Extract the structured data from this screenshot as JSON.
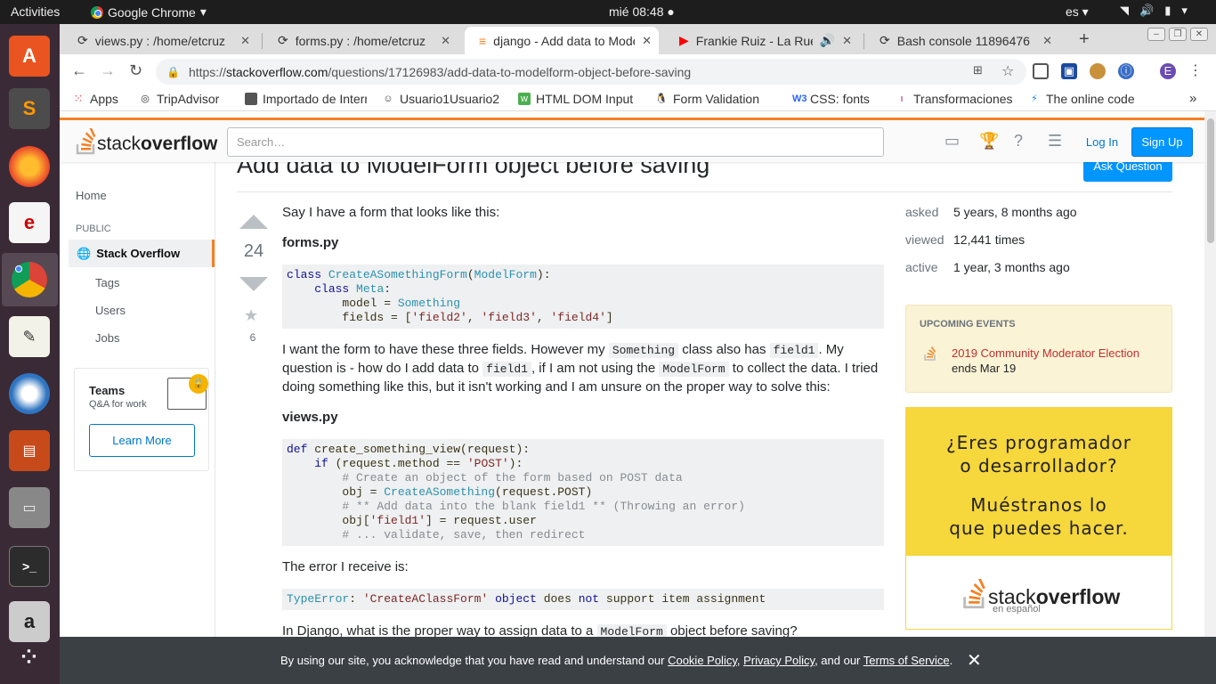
{
  "os": {
    "activities": "Activities",
    "app_name": "Google Chrome",
    "clock": "mié 08:48",
    "lang": "es"
  },
  "tabs": [
    {
      "title": "views.py : /home/etcruz",
      "active": false
    },
    {
      "title": "forms.py : /home/etcruz",
      "active": false
    },
    {
      "title": "django - Add data to ModelForm object before saving",
      "active": true
    },
    {
      "title": "Frankie Ruiz - La Rueda",
      "active": false
    },
    {
      "title": "Bash console 11896476",
      "active": false
    }
  ],
  "url": {
    "scheme": "https://",
    "host": "stackoverflow.com",
    "path": "/questions/17126983/add-data-to-modelform-object-before-saving"
  },
  "profile_initial": "E",
  "bookmarks": [
    "Apps",
    "TripAdvisor",
    "Importado de Internet",
    "Usuario1Usuario2",
    "HTML DOM Input",
    "Form Validation",
    "CSS: fonts",
    "Transformaciones",
    "The online code"
  ],
  "so": {
    "logo_light": "stack",
    "logo_bold": "overflow",
    "search_placeholder": "Search…",
    "login": "Log In",
    "signup": "Sign Up"
  },
  "leftnav": {
    "home": "Home",
    "public": "PUBLIC",
    "stack_overflow": "Stack Overflow",
    "tags": "Tags",
    "users": "Users",
    "jobs": "Jobs",
    "teams_title": "Teams",
    "teams_sub": "Q&A for work",
    "learn_more": "Learn More"
  },
  "question": {
    "title": "Add data to ModelForm object before saving",
    "ask_button": "Ask Question",
    "votes": "24",
    "favorites": "6",
    "p1": "Say I have a form that looks like this:",
    "h_forms": "forms.py",
    "p2_a": "I want the form to have these three fields. However my",
    "p2_code1": "Something",
    "p2_b": "class also has",
    "p2_code2": "field1",
    "p2_c": ". My question is - how do I add data to",
    "p2_code3": "field1",
    "p2_d": ", if I am not using the",
    "p2_code4": "ModelForm",
    "p2_e": "to collect the data. I tried doing something like this, but it isn't working and I am unsure on the proper way to solve this:",
    "h_views": "views.py",
    "p3": "The error I receive is:",
    "p4_a": "In Django, what is the proper way to assign data to a",
    "p4_code": "ModelForm",
    "p4_b": "object before saving?"
  },
  "stats": {
    "asked_label": "asked",
    "asked_value": "5 years, 8 months ago",
    "viewed_label": "viewed",
    "viewed_value": "12,441 times",
    "active_label": "active",
    "active_value": "1 year, 3 months ago"
  },
  "events": {
    "heading": "UPCOMING EVENTS",
    "link": "2019 Community Moderator Election",
    "sub": "ends Mar 19"
  },
  "ad": {
    "line1": "¿Eres programador",
    "line2": "o desarrollador?",
    "line3": "Muéstranos lo",
    "line4": "que puedes hacer.",
    "logo_light": "stack",
    "logo_bold": "overflow",
    "sub": "en español"
  },
  "cookie": {
    "text_a": "By using our site, you acknowledge that you have read and understand our",
    "cookie_policy": "Cookie Policy",
    "privacy_policy": "Privacy Policy",
    "text_b": ", and our",
    "terms": "Terms of Service",
    "text_c": "."
  }
}
